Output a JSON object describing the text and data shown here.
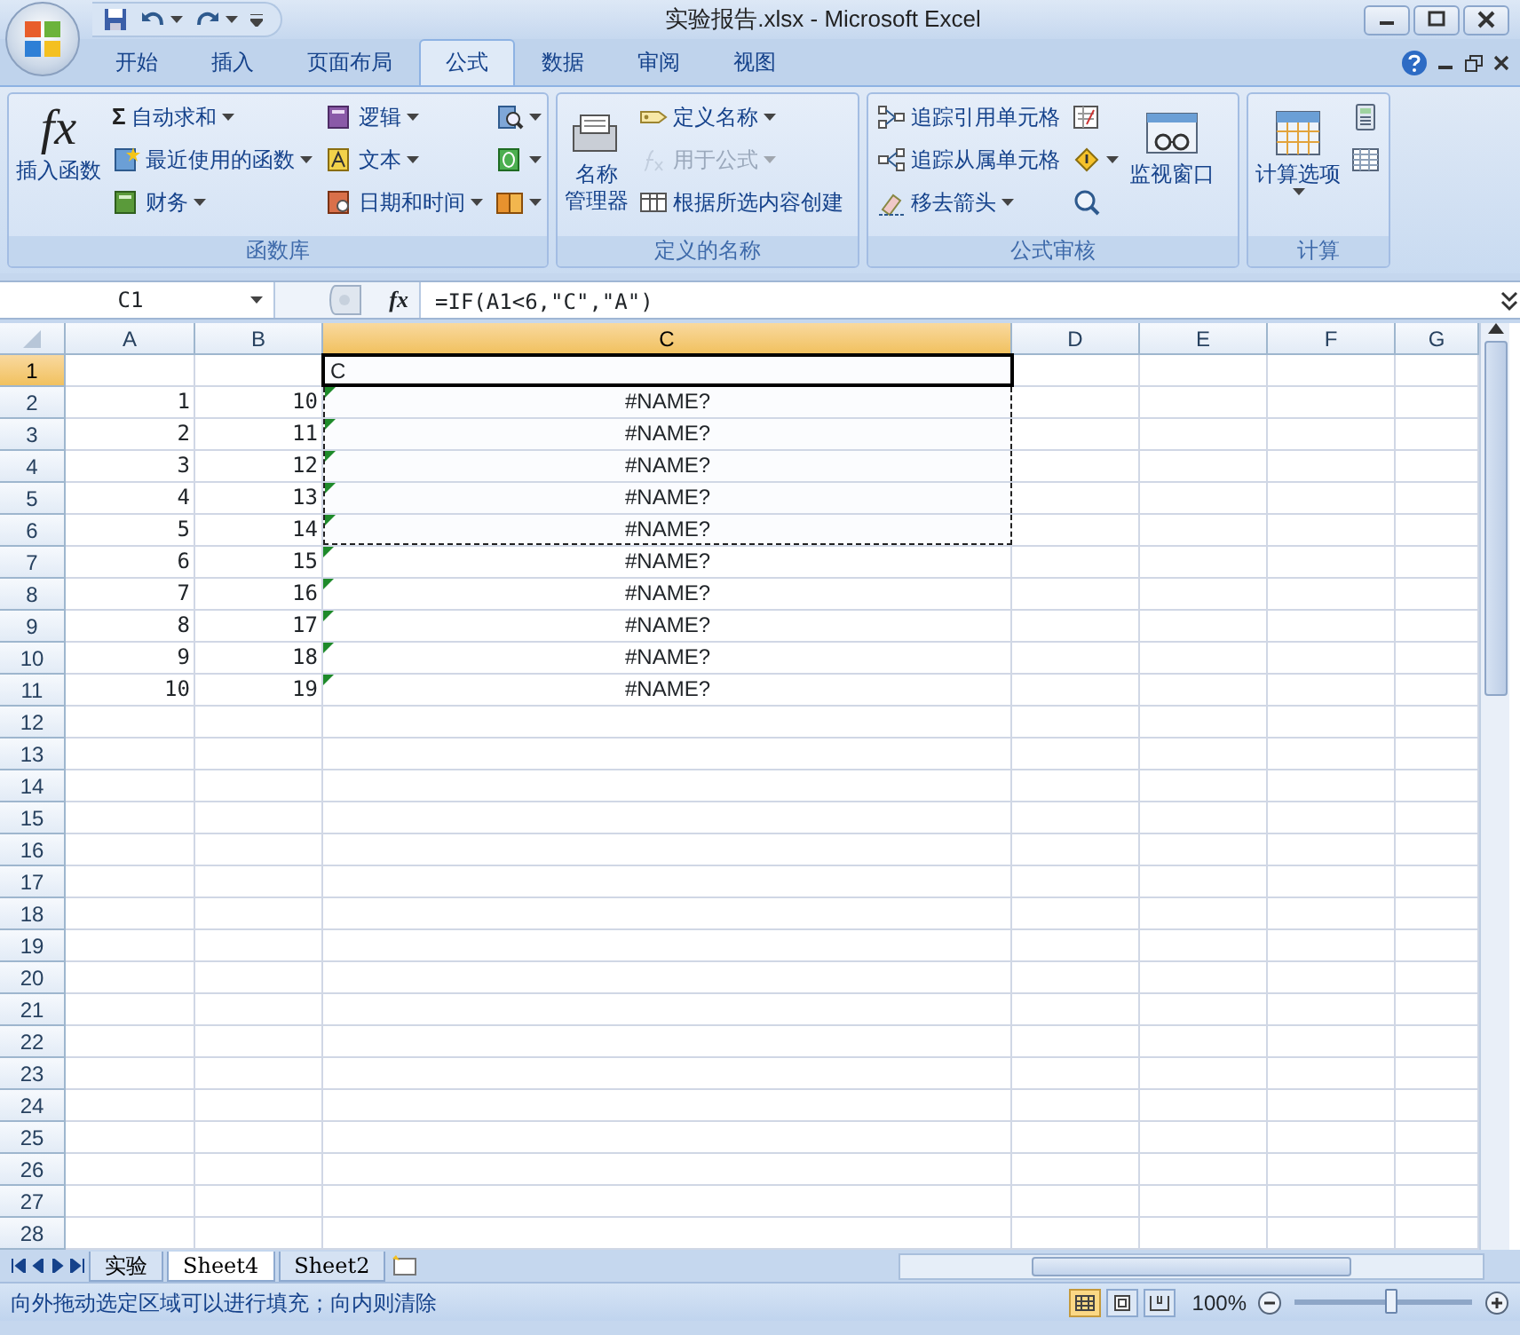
{
  "window": {
    "title": "实验报告.xlsx - Microsoft Excel"
  },
  "tabs": [
    {
      "label": "开始",
      "selected": false
    },
    {
      "label": "插入",
      "selected": false
    },
    {
      "label": "页面布局",
      "selected": false
    },
    {
      "label": "公式",
      "selected": true
    },
    {
      "label": "数据",
      "selected": false
    },
    {
      "label": "审阅",
      "selected": false
    },
    {
      "label": "视图",
      "selected": false
    }
  ],
  "ribbon": {
    "groups": [
      {
        "title": "函数库",
        "parts": [
          {
            "kind": "big",
            "lines": [
              "插入函数"
            ],
            "glyph": "fx",
            "dropdown": false
          },
          {
            "kind": "column",
            "items": [
              {
                "glyph": "Σ",
                "label": "自动求和",
                "dropdown": true,
                "disabled": false
              },
              {
                "label": "最近使用的函数",
                "dropdown": true,
                "disabled": false
              },
              {
                "label": "财务",
                "dropdown": true,
                "disabled": false
              }
            ]
          },
          {
            "kind": "column",
            "items": [
              {
                "label": "逻辑",
                "dropdown": true,
                "disabled": false
              },
              {
                "label": "文本",
                "dropdown": true,
                "disabled": false
              },
              {
                "label": "日期和时间",
                "dropdown": true,
                "disabled": false
              }
            ]
          },
          {
            "kind": "column",
            "items": [
              {
                "dropdown": true,
                "disabled": false
              },
              {
                "dropdown": true,
                "disabled": false
              },
              {
                "dropdown": true,
                "disabled": false
              }
            ]
          }
        ]
      },
      {
        "title": "定义的名称",
        "parts": [
          {
            "kind": "big",
            "lines": [
              "名称",
              "管理器"
            ],
            "dropdown": false
          },
          {
            "kind": "column",
            "items": [
              {
                "label": "定义名称",
                "dropdown": true,
                "disabled": false
              },
              {
                "label": "用于公式",
                "dropdown": true,
                "disabled": true
              },
              {
                "label": "根据所选内容创建",
                "dropdown": false,
                "disabled": false
              }
            ]
          }
        ]
      },
      {
        "title": "公式审核",
        "parts": [
          {
            "kind": "column",
            "items": [
              {
                "label": "追踪引用单元格",
                "dropdown": false,
                "disabled": false
              },
              {
                "label": "追踪从属单元格",
                "dropdown": false,
                "disabled": false
              },
              {
                "label": "移去箭头",
                "dropdown": true,
                "disabled": false
              }
            ]
          },
          {
            "kind": "column",
            "items": [
              {
                "dropdown": false,
                "disabled": false
              },
              {
                "dropdown": true,
                "disabled": false
              },
              {
                "dropdown": false,
                "disabled": false
              }
            ]
          },
          {
            "kind": "big",
            "lines": [
              "监视窗口"
            ],
            "dropdown": false
          }
        ]
      },
      {
        "title": "计算",
        "parts": [
          {
            "kind": "big",
            "lines": [
              "计算选项"
            ],
            "dropdown": true
          },
          {
            "kind": "column",
            "items": [
              {
                "dropdown": false,
                "disabled": false
              },
              {
                "dropdown": false,
                "disabled": false
              }
            ]
          }
        ]
      }
    ]
  },
  "formula_bar": {
    "name_box": "C1",
    "fx_glyph": "fx",
    "formula": "=IF(A1<6,\"C\",\"A\")"
  },
  "sheet": {
    "columns": [
      {
        "label": "A",
        "selected": false
      },
      {
        "label": "B",
        "selected": false
      },
      {
        "label": "C",
        "selected": true
      },
      {
        "label": "D",
        "selected": false
      },
      {
        "label": "E",
        "selected": false
      },
      {
        "label": "F",
        "selected": false
      },
      {
        "label": "G",
        "selected": false
      }
    ],
    "rows": [
      {
        "label": "1",
        "selected": true,
        "kind": "text",
        "copy_range": true,
        "error_flag": false,
        "C": "C"
      },
      {
        "label": "2",
        "selected": false,
        "kind": "data",
        "copy_range": true,
        "error_flag": true,
        "A": "1",
        "B": "10",
        "C": "#NAME?"
      },
      {
        "label": "3",
        "selected": false,
        "kind": "data",
        "copy_range": true,
        "error_flag": true,
        "A": "2",
        "B": "11",
        "C": "#NAME?"
      },
      {
        "label": "4",
        "selected": false,
        "kind": "data",
        "copy_range": true,
        "error_flag": true,
        "A": "3",
        "B": "12",
        "C": "#NAME?"
      },
      {
        "label": "5",
        "selected": false,
        "kind": "data",
        "copy_range": true,
        "error_flag": true,
        "A": "4",
        "B": "13",
        "C": "#NAME?"
      },
      {
        "label": "6",
        "selected": false,
        "kind": "data",
        "copy_range": true,
        "error_flag": true,
        "A": "5",
        "B": "14",
        "C": "#NAME?"
      },
      {
        "label": "7",
        "selected": false,
        "kind": "data",
        "copy_range": false,
        "error_flag": true,
        "A": "6",
        "B": "15",
        "C": "#NAME?"
      },
      {
        "label": "8",
        "selected": false,
        "kind": "data",
        "copy_range": false,
        "error_flag": true,
        "A": "7",
        "B": "16",
        "C": "#NAME?"
      },
      {
        "label": "9",
        "selected": false,
        "kind": "data",
        "copy_range": false,
        "error_flag": true,
        "A": "8",
        "B": "17",
        "C": "#NAME?"
      },
      {
        "label": "10",
        "selected": false,
        "kind": "data",
        "copy_range": false,
        "error_flag": true,
        "A": "9",
        "B": "18",
        "C": "#NAME?"
      },
      {
        "label": "11",
        "selected": false,
        "kind": "data",
        "copy_range": false,
        "error_flag": true,
        "A": "10",
        "B": "19",
        "C": "#NAME?"
      },
      {
        "label": "12",
        "selected": false
      },
      {
        "label": "13",
        "selected": false
      },
      {
        "label": "14",
        "selected": false
      },
      {
        "label": "15",
        "selected": false
      },
      {
        "label": "16",
        "selected": false
      },
      {
        "label": "17",
        "selected": false
      },
      {
        "label": "18",
        "selected": false
      },
      {
        "label": "19",
        "selected": false
      },
      {
        "label": "20",
        "selected": false
      },
      {
        "label": "21",
        "selected": false
      },
      {
        "label": "22",
        "selected": false
      },
      {
        "label": "23",
        "selected": false
      },
      {
        "label": "24",
        "selected": false
      },
      {
        "label": "25",
        "selected": false
      },
      {
        "label": "26",
        "selected": false
      },
      {
        "label": "27",
        "selected": false
      },
      {
        "label": "28",
        "selected": false
      }
    ]
  },
  "sheet_tabs": [
    {
      "label": "实验",
      "selected": false
    },
    {
      "label": "Sheet4",
      "selected": true
    },
    {
      "label": "Sheet2",
      "selected": false
    }
  ],
  "status_bar": {
    "message": "向外拖动选定区域可以进行填充；向内则清除",
    "view_buttons": [
      {
        "kind": "normal",
        "selected": true
      },
      {
        "kind": "page-layout",
        "selected": false
      },
      {
        "kind": "page-break",
        "selected": false
      }
    ],
    "zoom": "100%",
    "zoom_slider": {
      "level": 0.55
    }
  }
}
